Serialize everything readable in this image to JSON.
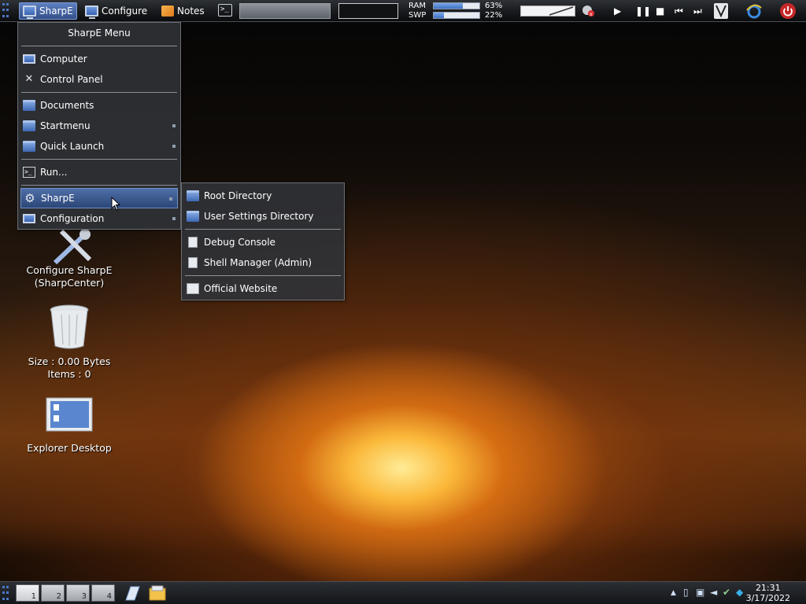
{
  "topbar": {
    "sharpe_button": "SharpE",
    "configure_button": "Configure",
    "notes_button": "Notes",
    "terminal_glyph": ">_",
    "ram_label": "RAM",
    "swp_label": "SWP",
    "ram_percent": "63%",
    "swp_percent": "22%",
    "ram_fraction": 0.63,
    "swp_fraction": 0.22
  },
  "main_menu": {
    "title": "SharpE Menu",
    "items": [
      {
        "label": "Computer",
        "icon": "computer-icon"
      },
      {
        "label": "Control Panel",
        "icon": "control-panel-icon"
      },
      {
        "label": "Documents",
        "icon": "folder-icon"
      },
      {
        "label": "Startmenu",
        "icon": "folder-icon"
      },
      {
        "label": "Quick Launch",
        "icon": "folder-icon"
      },
      {
        "label": "Run...",
        "icon": "run-icon"
      },
      {
        "label": "SharpE",
        "icon": "gear-icon"
      },
      {
        "label": "Configuration",
        "icon": "monitor-icon"
      }
    ]
  },
  "submenu": {
    "items": [
      {
        "label": "Root Directory",
        "icon": "folder-icon"
      },
      {
        "label": "User Settings Directory",
        "icon": "folder-icon"
      },
      {
        "label": "Debug Console",
        "icon": "document-icon"
      },
      {
        "label": "Shell Manager (Admin)",
        "icon": "document-icon"
      },
      {
        "label": "Official Website",
        "icon": "web-page-icon"
      }
    ]
  },
  "desktop": {
    "configure_line1": "Configure SharpE",
    "configure_line2": "(SharpCenter)",
    "recycle_size": "Size : 0.00 Bytes",
    "recycle_items": "Items : 0",
    "explorer_label": "Explorer Desktop"
  },
  "taskbar": {
    "workspaces": [
      "1",
      "2",
      "3",
      "4"
    ],
    "time": "21:31",
    "date": "3/17/2022"
  },
  "colors": {
    "accent": "#4a78c8",
    "menu_highlight": "#3d5a90"
  }
}
